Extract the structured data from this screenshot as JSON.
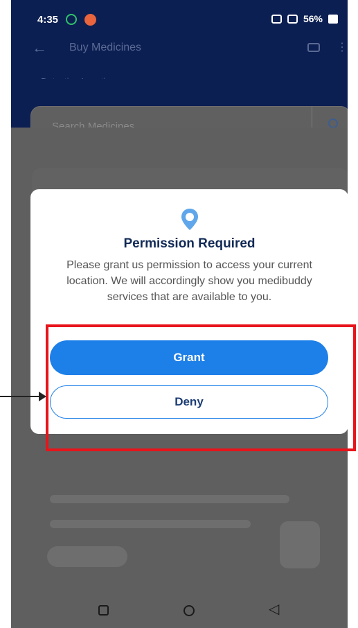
{
  "status_bar": {
    "time": "4:35",
    "battery": "56%"
  },
  "app_bar": {
    "title": "Buy Medicines",
    "location": "Detecting Location..."
  },
  "search": {
    "placeholder": "Search Medicines"
  },
  "dialog": {
    "title": "Permission Required",
    "message": "Please grant us permission to access your current location. We will accordingly show you medibuddy services that are available to you.",
    "grant_label": "Grant",
    "deny_label": "Deny"
  },
  "colors": {
    "primary": "#1d7fe8",
    "title": "#122a56",
    "highlight": "#e8141b",
    "app_bar": "#0c1f52"
  },
  "icons": [
    "back-icon",
    "cart-icon",
    "more-icon",
    "search-icon",
    "location-pin-icon",
    "nav-recents-icon",
    "nav-home-icon",
    "nav-back-icon"
  ]
}
